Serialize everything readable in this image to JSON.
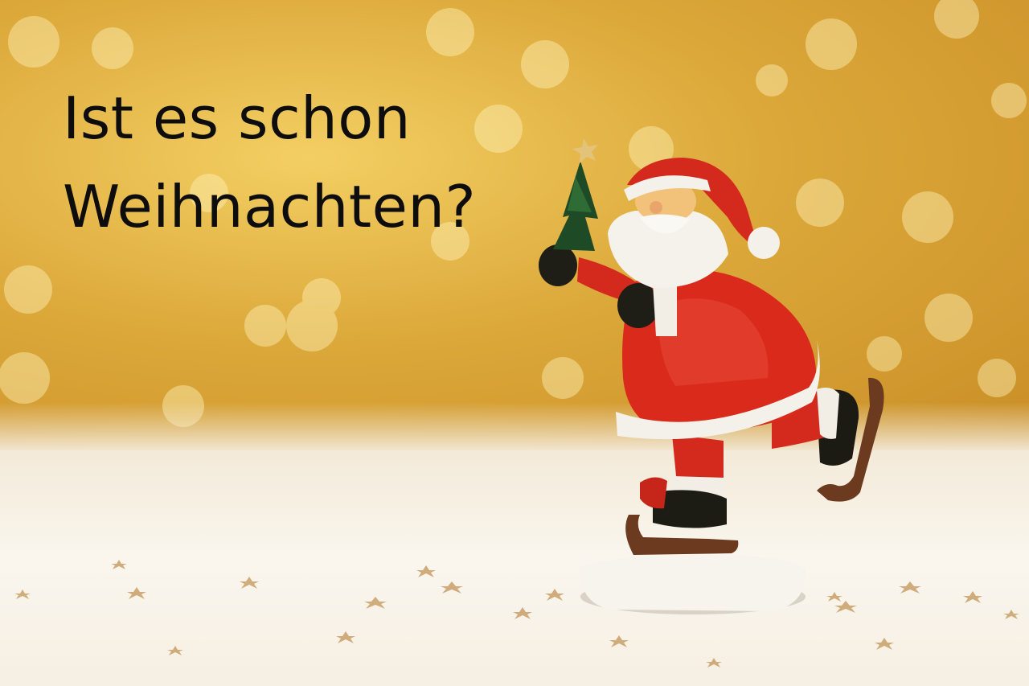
{
  "headline": {
    "line1": "Ist es schon",
    "line2": "Weihnachten?"
  },
  "colors": {
    "background_gold": "#e0ad3d",
    "snow_floor": "#faf6ee",
    "santa_red": "#d92a1c",
    "fur_white": "#f5f2ec",
    "headline_text": "#0d0d0d"
  },
  "objects": [
    "santa-figurine",
    "christmas-tree",
    "ice-skates",
    "snow-base",
    "golden-stars",
    "bokeh-lights"
  ]
}
